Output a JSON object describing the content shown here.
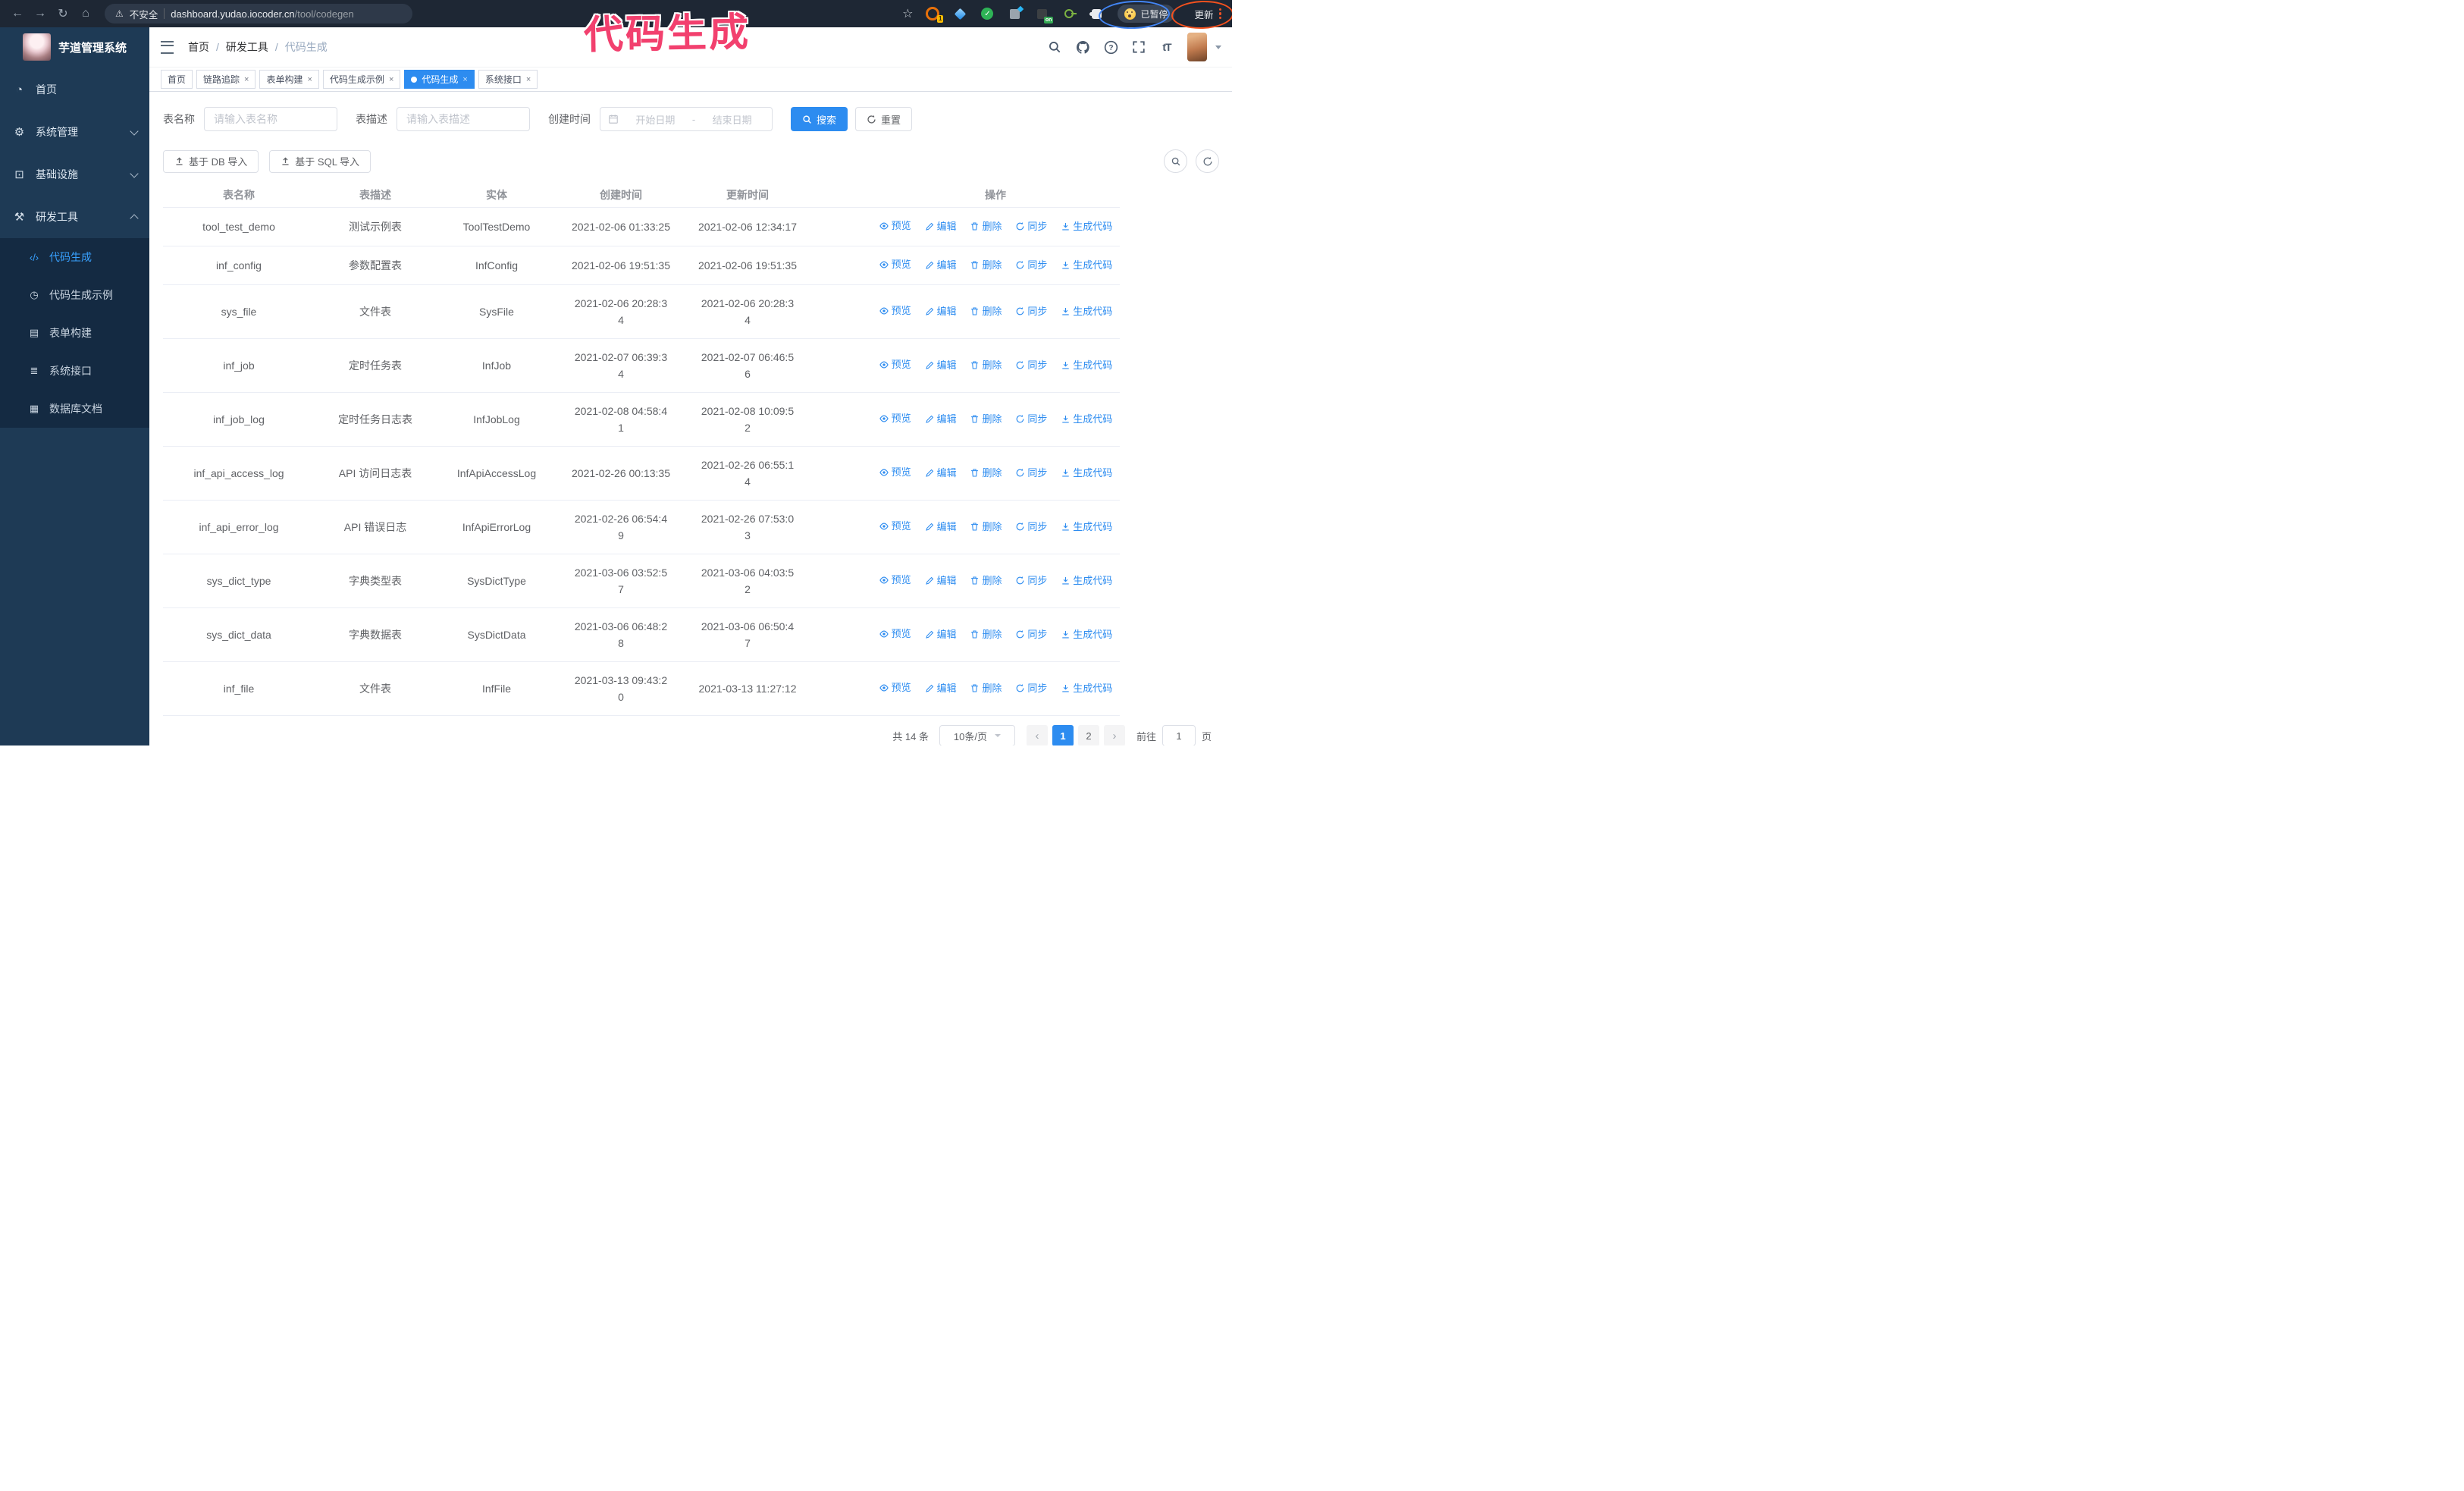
{
  "colors": {
    "accent_blue": "#2d8cf0",
    "sidebar_bg": "#1e3a55",
    "submenu_bg": "#142a42",
    "annotation_pink": "#f2406e",
    "annotation_blue": "#4285f4",
    "annotation_red": "#f4511e"
  },
  "annotation": {
    "title_text": "代码生成"
  },
  "browser": {
    "security_text": "不安全",
    "url_host": "dashboard.yudao.iocoder.cn",
    "url_path": "/tool/codegen",
    "extension_badge": "1",
    "extension_on_label": "on",
    "paused_label": "已暂停",
    "update_label": "更新"
  },
  "sidebar": {
    "app_title": "芋道管理系统",
    "items": [
      {
        "label": "首页",
        "icon": "dashboard-icon",
        "expandable": false,
        "expanded": false
      },
      {
        "label": "系统管理",
        "icon": "gear-icon",
        "expandable": true,
        "expanded": false
      },
      {
        "label": "基础设施",
        "icon": "infrastructure-icon",
        "expandable": true,
        "expanded": false
      },
      {
        "label": "研发工具",
        "icon": "toolbox-icon",
        "expandable": true,
        "expanded": true
      }
    ],
    "subitems": [
      {
        "label": "代码生成",
        "icon": "code-icon",
        "active": true
      },
      {
        "label": "代码生成示例",
        "icon": "example-icon",
        "active": false
      },
      {
        "label": "表单构建",
        "icon": "form-builder-icon",
        "active": false
      },
      {
        "label": "系统接口",
        "icon": "api-icon",
        "active": false
      },
      {
        "label": "数据库文档",
        "icon": "database-doc-icon",
        "active": false
      }
    ]
  },
  "header": {
    "breadcrumb": [
      "首页",
      "研发工具",
      "代码生成"
    ]
  },
  "tabs": [
    {
      "label": "首页",
      "active": false,
      "closable": false
    },
    {
      "label": "链路追踪",
      "active": false,
      "closable": true
    },
    {
      "label": "表单构建",
      "active": false,
      "closable": true
    },
    {
      "label": "代码生成示例",
      "active": false,
      "closable": true
    },
    {
      "label": "代码生成",
      "active": true,
      "closable": true
    },
    {
      "label": "系统接口",
      "active": false,
      "closable": true
    }
  ],
  "filters": {
    "table_name_label": "表名称",
    "table_name_placeholder": "请输入表名称",
    "table_desc_label": "表描述",
    "table_desc_placeholder": "请输入表描述",
    "create_time_label": "创建时间",
    "date_start_placeholder": "开始日期",
    "date_separator": "-",
    "date_end_placeholder": "结束日期",
    "search_label": "搜索",
    "reset_label": "重置"
  },
  "toolbar": {
    "db_import_label": "基于 DB 导入",
    "sql_import_label": "基于 SQL 导入"
  },
  "table": {
    "columns": [
      "表名称",
      "表描述",
      "实体",
      "创建时间",
      "更新时间",
      "操作"
    ],
    "action_labels": {
      "preview": "预览",
      "edit": "编辑",
      "delete": "删除",
      "sync": "同步",
      "generate": "生成代码"
    },
    "rows": [
      {
        "name": "tool_test_demo",
        "description": "测试示例表",
        "entity": "ToolTestDemo",
        "created": "2021-02-06 01:33:25",
        "updated": "2021-02-06 12:34:17"
      },
      {
        "name": "inf_config",
        "description": "参数配置表",
        "entity": "InfConfig",
        "created": "2021-02-06 19:51:35",
        "updated": "2021-02-06 19:51:35"
      },
      {
        "name": "sys_file",
        "description": "文件表",
        "entity": "SysFile",
        "created": "2021-02-06 20:28:3\n4",
        "updated": "2021-02-06 20:28:3\n4"
      },
      {
        "name": "inf_job",
        "description": "定时任务表",
        "entity": "InfJob",
        "created": "2021-02-07 06:39:3\n4",
        "updated": "2021-02-07 06:46:5\n6"
      },
      {
        "name": "inf_job_log",
        "description": "定时任务日志表",
        "entity": "InfJobLog",
        "created": "2021-02-08 04:58:4\n1",
        "updated": "2021-02-08 10:09:5\n2"
      },
      {
        "name": "inf_api_access_log",
        "description": "API 访问日志表",
        "entity": "InfApiAccessLog",
        "created": "2021-02-26 00:13:35",
        "updated": "2021-02-26 06:55:1\n4"
      },
      {
        "name": "inf_api_error_log",
        "description": "API 错误日志",
        "entity": "InfApiErrorLog",
        "created": "2021-02-26 06:54:4\n9",
        "updated": "2021-02-26 07:53:0\n3"
      },
      {
        "name": "sys_dict_type",
        "description": "字典类型表",
        "entity": "SysDictType",
        "created": "2021-03-06 03:52:5\n7",
        "updated": "2021-03-06 04:03:5\n2"
      },
      {
        "name": "sys_dict_data",
        "description": "字典数据表",
        "entity": "SysDictData",
        "created": "2021-03-06 06:48:2\n8",
        "updated": "2021-03-06 06:50:4\n7"
      },
      {
        "name": "inf_file",
        "description": "文件表",
        "entity": "InfFile",
        "created": "2021-03-13 09:43:2\n0",
        "updated": "2021-03-13 11:27:12"
      }
    ]
  },
  "pagination": {
    "total_text": "共 14 条",
    "page_size_text": "10条/页",
    "pages": [
      "1",
      "2"
    ],
    "active_page": "1",
    "prev_symbol": "‹",
    "next_symbol": "›",
    "goto_label": "前往",
    "goto_value": "1",
    "page_unit": "页"
  }
}
